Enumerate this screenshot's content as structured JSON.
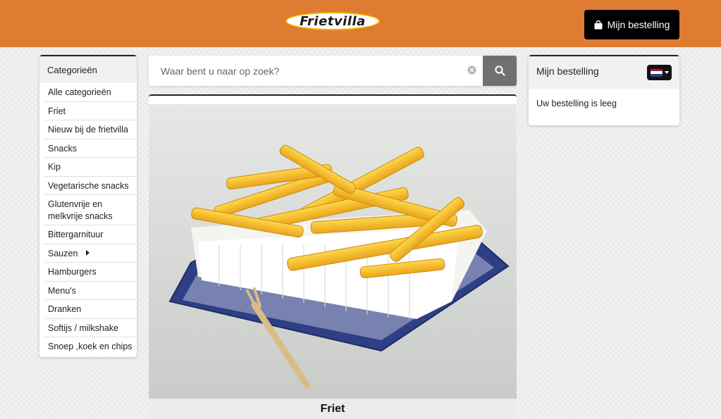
{
  "header": {
    "logo_text": "Frietvilla",
    "order_button_label": "Mijn bestelling"
  },
  "sidebar": {
    "title": "Categorieën",
    "items": [
      {
        "label": "Alle categorieën"
      },
      {
        "label": "Friet"
      },
      {
        "label": "Nieuw bij de frietvilla"
      },
      {
        "label": "Snacks"
      },
      {
        "label": "Kip"
      },
      {
        "label": "Vegetarische snacks"
      },
      {
        "label": "Glutenvrije en melkvrije snacks"
      },
      {
        "label": "Bittergarnituur"
      },
      {
        "label": "Sauzen",
        "has_submenu": true
      },
      {
        "label": "Hamburgers"
      },
      {
        "label": "Menu's"
      },
      {
        "label": "Dranken"
      },
      {
        "label": "Softijs / milkshake"
      },
      {
        "label": "Snoep ,koek en chips"
      }
    ]
  },
  "search": {
    "placeholder": "Waar bent u naar op zoek?",
    "value": ""
  },
  "product": {
    "name": "Friet"
  },
  "order_panel": {
    "title": "Mijn bestelling",
    "empty_text": "Uw bestelling is leeg",
    "language_flag": "nl-flag-icon"
  },
  "colors": {
    "header": "#e07b32",
    "search_button": "#707070",
    "primary_button": "#000000",
    "flag_red": "#ae1c28",
    "flag_white": "#ffffff",
    "flag_blue": "#21468b"
  }
}
